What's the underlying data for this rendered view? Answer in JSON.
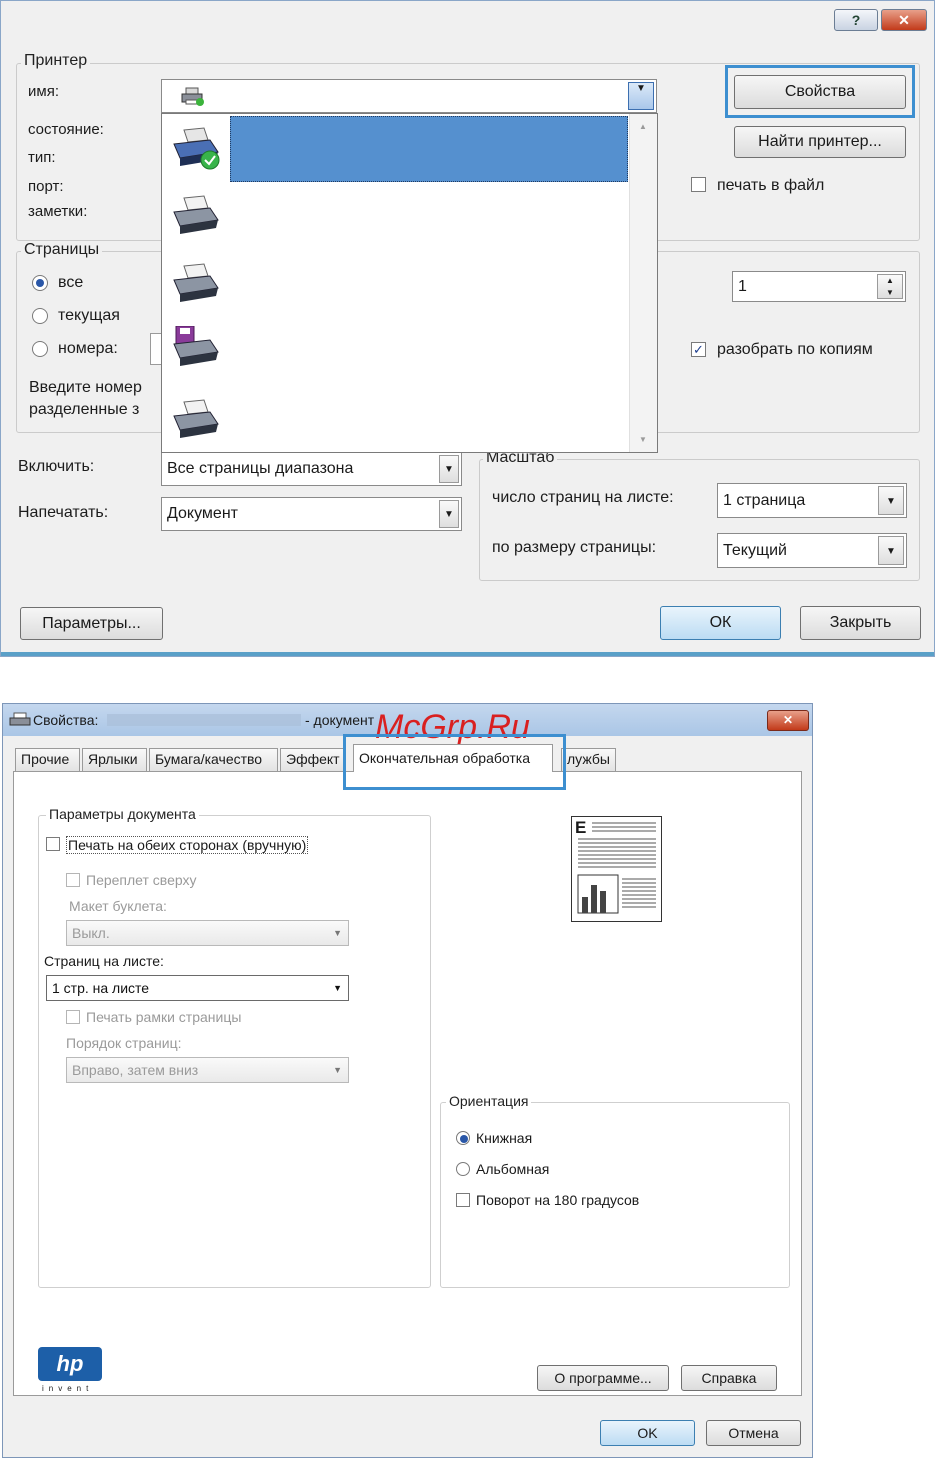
{
  "print_dialog": {
    "title_help": "?",
    "title_close": "✕",
    "printer_group": "Принтер",
    "name_label": "имя:",
    "status_label": "состояние:",
    "type_label": "тип:",
    "port_label": "порт:",
    "notes_label": "заметки:",
    "properties_button": "Свойства",
    "find_printer_button": "Найти принтер...",
    "print_to_file_label": "печать в файл",
    "pages_group": "Страницы",
    "radio_all": "все",
    "radio_current": "текущая",
    "radio_numbers": "номера:",
    "hint_text_1": "Введите номер",
    "hint_text_2": "разделенные з",
    "copies_value": "1",
    "collate_label": "разобрать по копиям",
    "include_label": "Включить:",
    "include_value": "Все страницы диапазона",
    "print_label": "Напечатать:",
    "print_value": "Документ",
    "scale_group": "Масштаб",
    "pages_per_sheet_label": "число страниц на листе:",
    "pages_per_sheet_value": "1 страница",
    "fit_label": "по размеру страницы:",
    "fit_value": "Текущий",
    "params_button": "Параметры...",
    "ok_button": "ОК",
    "close_button": "Закрыть"
  },
  "props_dialog": {
    "title": "Свойства:",
    "title_suffix": "- документ",
    "watermark": "McGrp.Ru",
    "tabs": [
      "Прочие",
      "Ярлыки",
      "Бумага/качество",
      "Эффект",
      "Окончательная обработка",
      "лужбы"
    ],
    "doc_params_group": "Параметры документа",
    "duplex_label": "Печать на обеих сторонах (вручную)",
    "binding_label": "Переплет сверху",
    "booklet_label": "Макет буклета:",
    "booklet_value": "Выкл.",
    "pages_per_sheet_label": "Страниц на листе:",
    "pages_per_sheet_value": "1 стр. на листе",
    "borders_label": "Печать рамки страницы",
    "order_label": "Порядок страниц:",
    "order_value": "Вправо, затем вниз",
    "orientation_group": "Ориентация",
    "portrait_label": "Книжная",
    "landscape_label": "Альбомная",
    "rotate_label": "Поворот на 180 градусов",
    "about_button": "О программе...",
    "help_button": "Справка",
    "ok_button": "OK",
    "cancel_button": "Отмена",
    "preview_letter": "E",
    "logo_text": "hp",
    "logo_sub": "invent"
  },
  "colors": {
    "accent": "#3d8fd0",
    "selection": "#5590cf"
  }
}
